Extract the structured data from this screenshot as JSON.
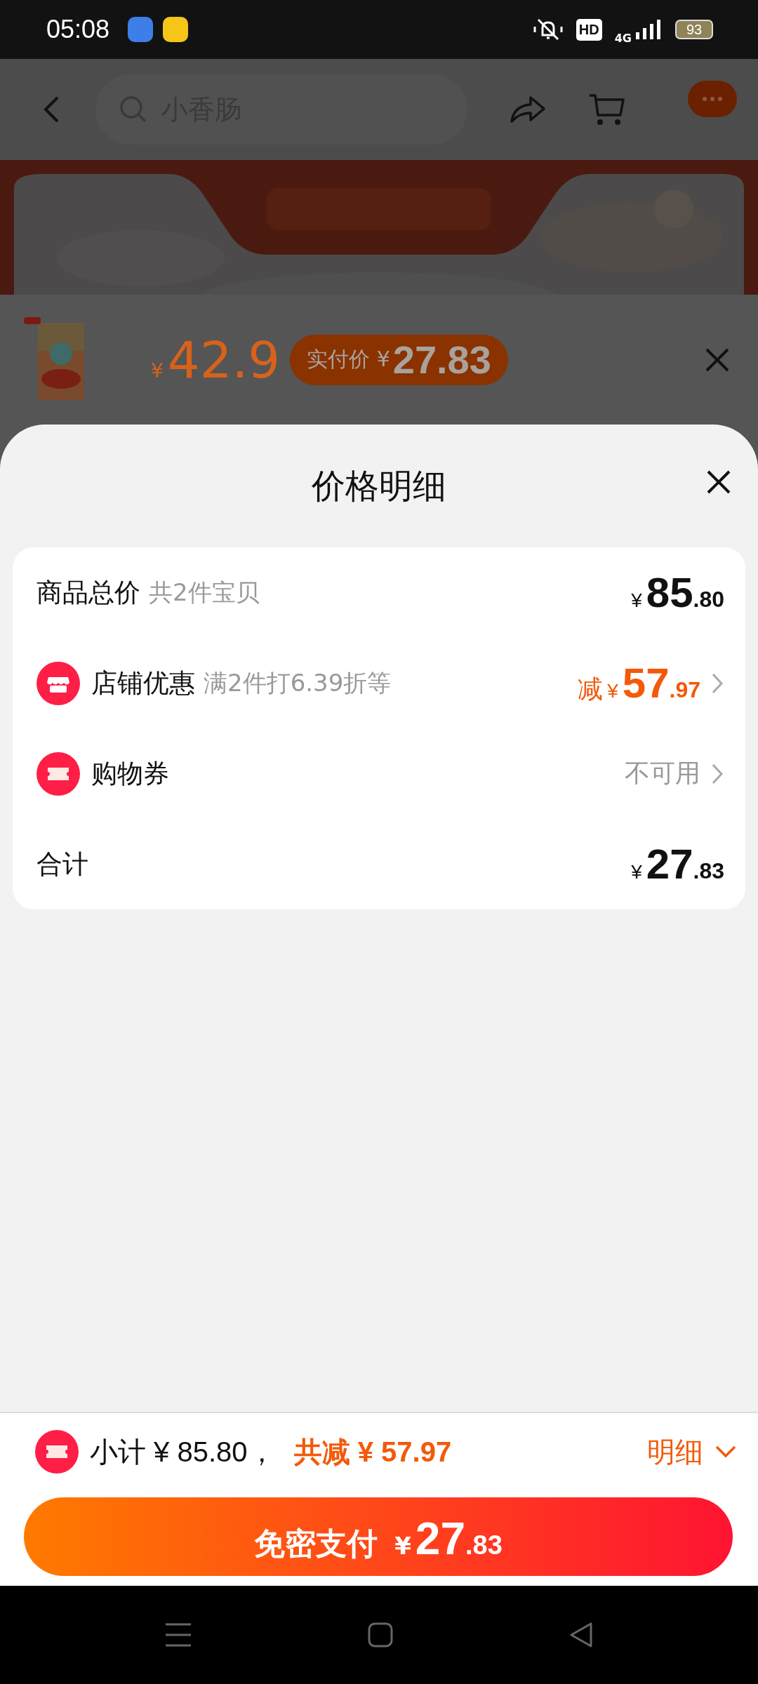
{
  "status_bar": {
    "time": "05:08",
    "hd": "HD",
    "network": "4G",
    "battery": "93"
  },
  "background_page": {
    "search": {
      "placeholder": "小香肠"
    },
    "product": {
      "price_symbol": "¥",
      "price": "42.9",
      "badge_label": "实付价",
      "badge_symbol": "¥",
      "badge_price": "27.83"
    }
  },
  "sheet": {
    "title": "价格明细",
    "rows": [
      {
        "kind": "total",
        "label": "商品总价",
        "note": "共2件宝贝",
        "symbol": "¥",
        "integer": "85",
        "decimal": ".80"
      },
      {
        "kind": "discount",
        "label": "店铺优惠",
        "note": "满2件打6.39折等",
        "prefix": "减",
        "symbol": "¥",
        "integer": "57",
        "decimal": ".97"
      },
      {
        "kind": "status",
        "label": "购物券",
        "status": "不可用"
      },
      {
        "kind": "total",
        "label": "合计",
        "symbol": "¥",
        "integer": "27",
        "decimal": ".83"
      }
    ]
  },
  "footer": {
    "subtotal": "小计 ¥ 85.80，",
    "saving": "共减 ¥ 57.97",
    "detail": "明细",
    "pay_button": {
      "label": "免密支付",
      "symbol": "¥",
      "integer": "27",
      "decimal": ".83"
    }
  }
}
